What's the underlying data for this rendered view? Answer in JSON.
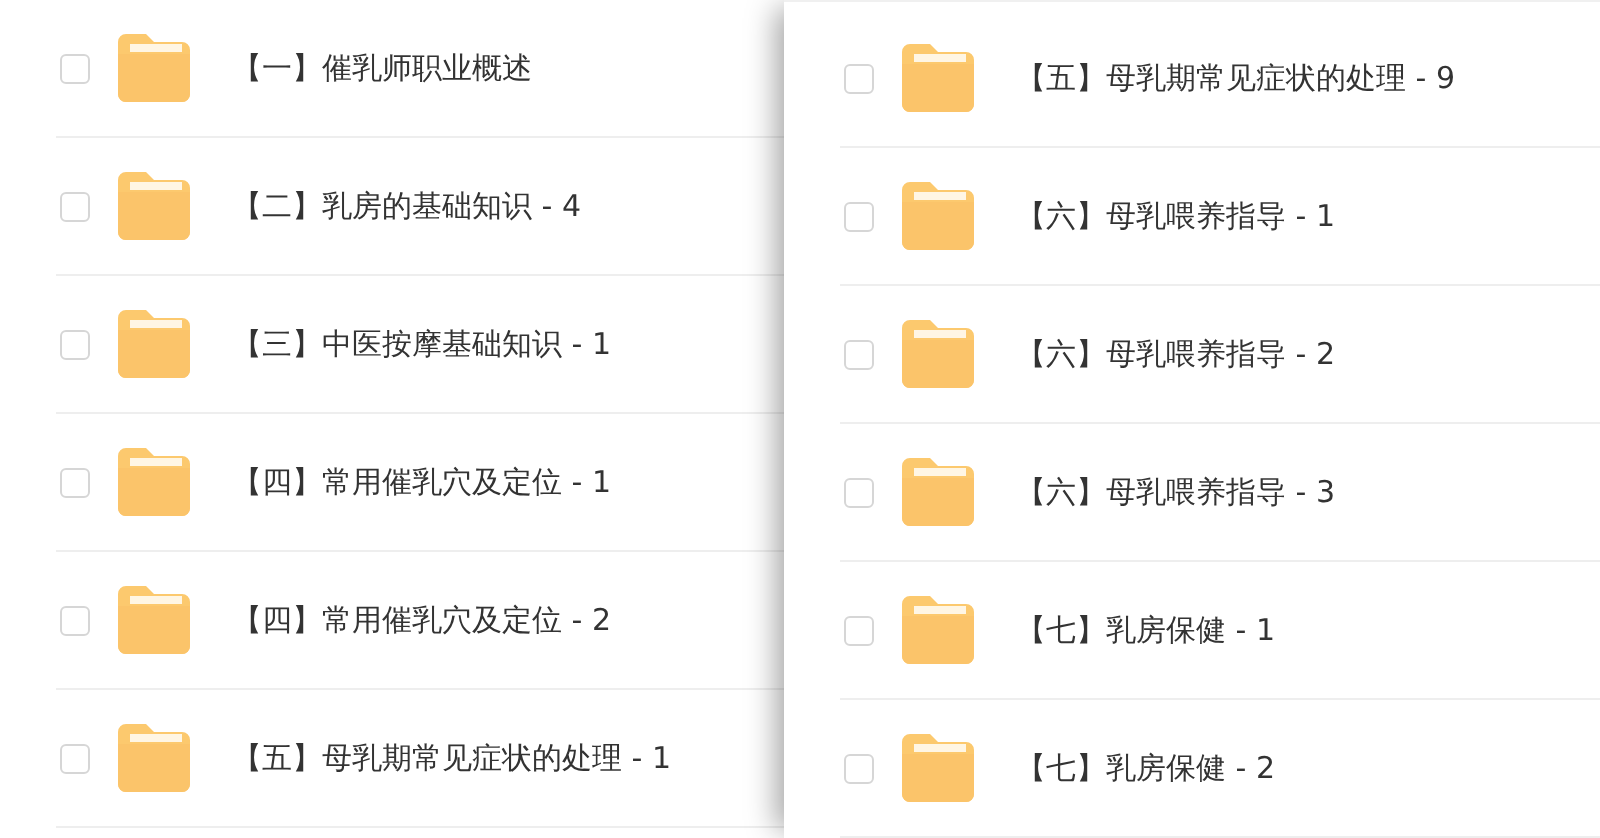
{
  "panels": [
    {
      "items": [
        {
          "name": "【一】催乳师职业概述",
          "checked": false
        },
        {
          "name": "【二】乳房的基础知识 - 4",
          "checked": false
        },
        {
          "name": "【三】中医按摩基础知识 - 1",
          "checked": false
        },
        {
          "name": "【四】常用催乳穴及定位 - 1",
          "checked": false
        },
        {
          "name": "【四】常用催乳穴及定位 - 2",
          "checked": false
        },
        {
          "name": "【五】母乳期常见症状的处理 - 1",
          "checked": false
        }
      ]
    },
    {
      "items": [
        {
          "name": "【五】母乳期常见症状的处理 - 9",
          "checked": false
        },
        {
          "name": "【六】母乳喂养指导 - 1",
          "checked": false
        },
        {
          "name": "【六】母乳喂养指导 - 2",
          "checked": false
        },
        {
          "name": "【六】母乳喂养指导 - 3",
          "checked": false
        },
        {
          "name": "【七】乳房保健 - 1",
          "checked": false
        },
        {
          "name": "【七】乳房保健 - 2",
          "checked": false
        }
      ]
    }
  ]
}
